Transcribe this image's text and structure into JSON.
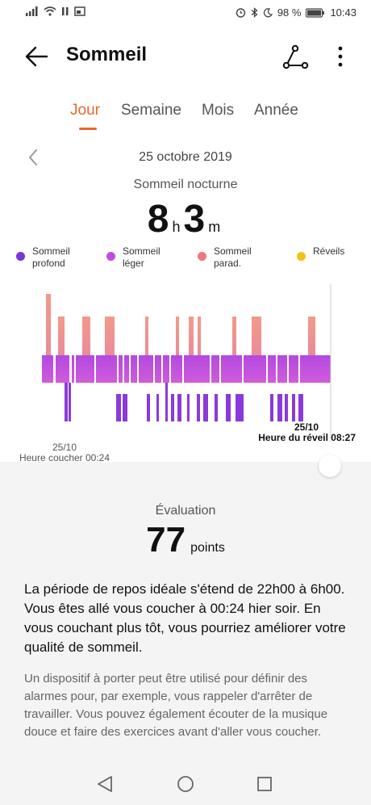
{
  "status": {
    "battery": "98 %",
    "time": "10:43"
  },
  "header": {
    "title": "Sommeil"
  },
  "tabs": [
    {
      "label": "Jour",
      "active": true
    },
    {
      "label": "Semaine",
      "active": false
    },
    {
      "label": "Mois",
      "active": false
    },
    {
      "label": "Année",
      "active": false
    }
  ],
  "date": "25 octobre 2019",
  "summary": {
    "title": "Sommeil nocturne",
    "hours": "8",
    "hours_unit": "h",
    "minutes": "3",
    "minutes_unit": "m"
  },
  "legend": [
    {
      "label": "Sommeil profond",
      "color": "#7d35d9"
    },
    {
      "label": "Sommeil léger",
      "color": "#c24ce0"
    },
    {
      "label": "Sommeil parad.",
      "color": "#f0787a"
    },
    {
      "label": "Réveils",
      "color": "#f2c21a"
    }
  ],
  "chart": {
    "start_date": "25/10",
    "start_label": "Heure coucher 00:24",
    "end_date": "25/10",
    "end_label": "Heure du réveil 08:27"
  },
  "evaluation": {
    "title": "Évaluation",
    "score": "77",
    "unit": "points",
    "text": "La période de repos idéale s'étend de 22h00 à 6h00. Vous êtes allé vous coucher à 00:24 hier soir. En vous couchant plus tôt, vous pourriez améliorer votre qualité de sommeil.",
    "tip": "Un dispositif à porter peut être utilisé pour définir des alarmes pour, par exemple, vous rappeler d'arrêter de travailler. Vous pouvez également écouter de la musique douce et faire des exercices avant d'aller vous coucher."
  }
}
